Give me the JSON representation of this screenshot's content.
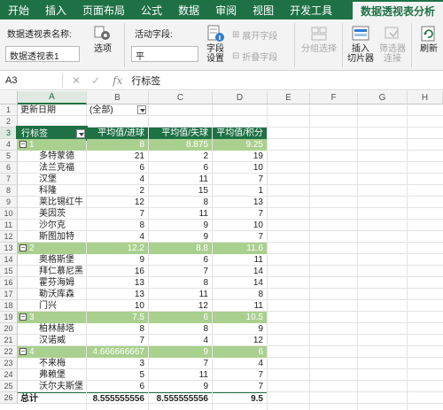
{
  "tabs": [
    {
      "label": "开始",
      "active": false
    },
    {
      "label": "插入",
      "active": false
    },
    {
      "label": "页面布局",
      "active": false
    },
    {
      "label": "公式",
      "active": false
    },
    {
      "label": "数据",
      "active": false
    },
    {
      "label": "审阅",
      "active": false
    },
    {
      "label": "视图",
      "active": false
    },
    {
      "label": "开发工具",
      "active": false
    },
    {
      "label": "数据透视表分析",
      "active": true
    }
  ],
  "ribbon": {
    "pivot_name_label": "数据透视表名称:",
    "pivot_name_value": "数据透视表1",
    "options_label": "选项",
    "active_field_label": "活动字段:",
    "active_field_value": "平",
    "field_settings_label1": "字段",
    "field_settings_label2": "设置",
    "expand_field": "展开字段",
    "collapse_field": "折叠字段",
    "group_selection": "分组选择",
    "insert_slicer1": "插入",
    "insert_slicer2": "切片器",
    "filter_connections1": "筛选器",
    "filter_connections2": "连接",
    "refresh": "刷新"
  },
  "formula_bar": {
    "cell_ref": "A3",
    "content": "行标签"
  },
  "columns": [
    "A",
    "B",
    "C",
    "D",
    "E",
    "F",
    "G",
    "H"
  ],
  "selected_column": "A",
  "selected_row": "3",
  "filter": {
    "label": "更新日期",
    "value": "(全部)"
  },
  "pivot_headers": [
    "行标签",
    "平均值/进球",
    "平均值/失球",
    "平均值/积分"
  ],
  "rows": [
    {
      "row": "1",
      "type": "filter"
    },
    {
      "row": "2",
      "type": "empty"
    },
    {
      "row": "3",
      "type": "header"
    },
    {
      "row": "4",
      "type": "group",
      "label": "1",
      "b": "8",
      "c": "8.875",
      "d": "9.25"
    },
    {
      "row": "5",
      "type": "item",
      "label": "多特蒙德",
      "b": "21",
      "c": "2",
      "d": "19"
    },
    {
      "row": "6",
      "type": "item",
      "label": "法兰克福",
      "b": "6",
      "c": "6",
      "d": "10"
    },
    {
      "row": "7",
      "type": "item",
      "label": "汉堡",
      "b": "4",
      "c": "11",
      "d": "7"
    },
    {
      "row": "8",
      "type": "item",
      "label": "科隆",
      "b": "2",
      "c": "15",
      "d": "1"
    },
    {
      "row": "9",
      "type": "item",
      "label": "莱比锡红牛",
      "b": "12",
      "c": "8",
      "d": "13"
    },
    {
      "row": "10",
      "type": "item",
      "label": "美因茨",
      "b": "7",
      "c": "11",
      "d": "7"
    },
    {
      "row": "11",
      "type": "item",
      "label": "沙尔克",
      "b": "8",
      "c": "9",
      "d": "10"
    },
    {
      "row": "12",
      "type": "item",
      "label": "斯图加特",
      "b": "4",
      "c": "9",
      "d": "7"
    },
    {
      "row": "13",
      "type": "group",
      "label": "2",
      "b": "12.2",
      "c": "8.8",
      "d": "11.6"
    },
    {
      "row": "14",
      "type": "item",
      "label": "奥格斯堡",
      "b": "9",
      "c": "6",
      "d": "11"
    },
    {
      "row": "15",
      "type": "item",
      "label": "拜仁慕尼黑",
      "b": "16",
      "c": "7",
      "d": "14"
    },
    {
      "row": "16",
      "type": "item",
      "label": "霍芬海姆",
      "b": "13",
      "c": "8",
      "d": "14"
    },
    {
      "row": "17",
      "type": "item",
      "label": "勒沃库森",
      "b": "13",
      "c": "11",
      "d": "8"
    },
    {
      "row": "18",
      "type": "item",
      "label": "门兴",
      "b": "10",
      "c": "12",
      "d": "11"
    },
    {
      "row": "19",
      "type": "group",
      "label": "3",
      "b": "7.5",
      "c": "6",
      "d": "10.5"
    },
    {
      "row": "20",
      "type": "item",
      "label": "柏林赫塔",
      "b": "8",
      "c": "8",
      "d": "9"
    },
    {
      "row": "21",
      "type": "item",
      "label": "汉诺威",
      "b": "7",
      "c": "4",
      "d": "12"
    },
    {
      "row": "22",
      "type": "group",
      "label": "4",
      "b": "4.666666667",
      "c": "9",
      "d": "6"
    },
    {
      "row": "23",
      "type": "item",
      "label": "不来梅",
      "b": "3",
      "c": "7",
      "d": "4"
    },
    {
      "row": "24",
      "type": "item",
      "label": "弗赖堡",
      "b": "5",
      "c": "11",
      "d": "7"
    },
    {
      "row": "25",
      "type": "item",
      "label": "沃尔夫斯堡",
      "b": "6",
      "c": "9",
      "d": "7"
    },
    {
      "row": "26",
      "type": "total",
      "label": "总计",
      "b": "8.555555556",
      "c": "8.555555556",
      "d": "9.5"
    }
  ],
  "colors": {
    "ribbon_green": "#1e7145",
    "group_row": "#a9d08e",
    "header_row": "#1e7145"
  }
}
